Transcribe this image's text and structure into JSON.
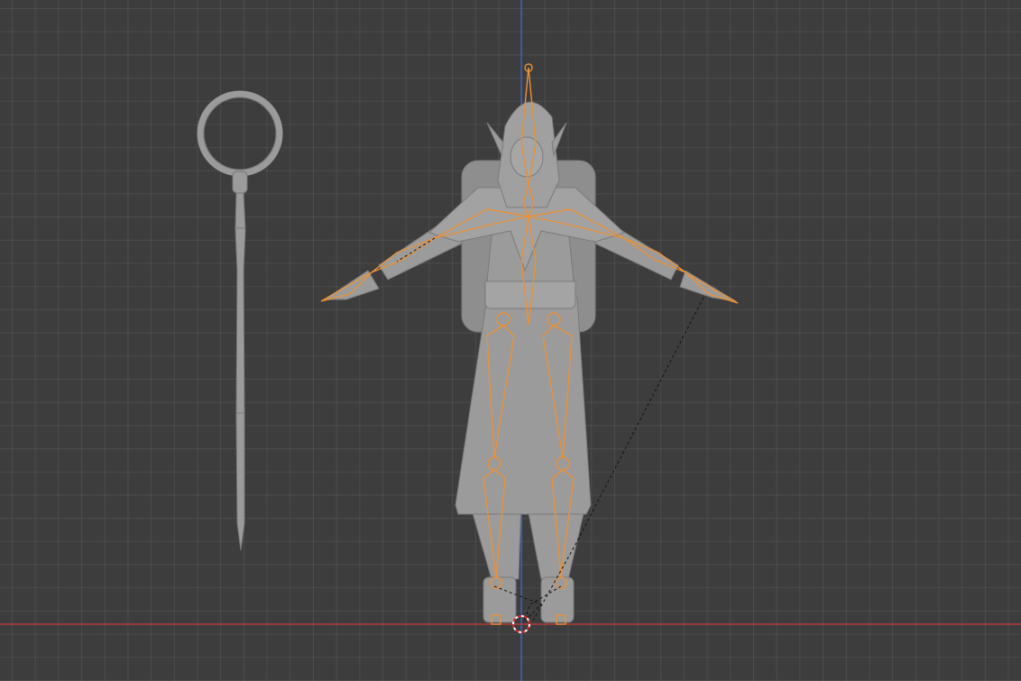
{
  "viewport": {
    "colors": {
      "background": "#3d3d3d",
      "grid": "#4a4a4a",
      "x_axis": "#b33a3a",
      "z_axis": "#3d62b8",
      "armature_selected": "#e8913a",
      "mesh": "#9b9b9b",
      "mesh_shadow": "#7c7c7c",
      "relationship_line": "#111111"
    },
    "objects": [
      {
        "name": "staff-mesh",
        "type": "mesh"
      },
      {
        "name": "character-mesh",
        "type": "mesh"
      },
      {
        "name": "armature",
        "type": "armature",
        "selected": true
      },
      {
        "name": "3d-cursor",
        "type": "cursor"
      }
    ]
  }
}
